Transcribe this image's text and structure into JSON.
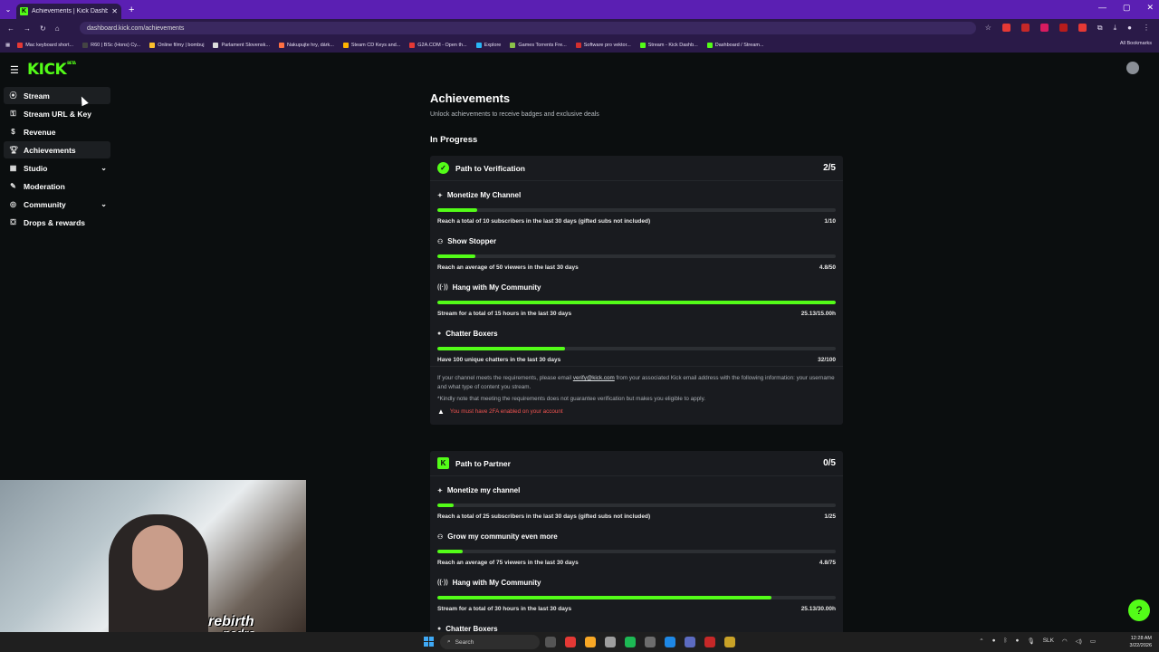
{
  "browser": {
    "tab_title": "Achievements | Kick Dashboard",
    "tab_favicon": "K",
    "url": "dashboard.kick.com/achievements",
    "bookmarks": [
      "Mac keyboard short...",
      "R60 | BSc (Hons) Cy...",
      "Online filmy | bombuj",
      "Parlament Slovensk...",
      "Nakupujte hry, dárk...",
      "Steam CD Keys and...",
      "G2A.COM - Open th...",
      "Explore",
      "Games Torrents Fre...",
      "Software pro vektor...",
      "Stream - Kick Dashb...",
      "Dashboard / Stream..."
    ],
    "all_bookmarks": "All Bookmarks"
  },
  "app": {
    "logo": "KICK",
    "logo_tag": "BETA"
  },
  "sidebar": {
    "items": [
      {
        "label": "Stream",
        "icon": "broadcast-icon"
      },
      {
        "label": "Stream URL & Key",
        "icon": "key-icon"
      },
      {
        "label": "Revenue",
        "icon": "dollar-icon"
      },
      {
        "label": "Achievements",
        "icon": "trophy-icon"
      },
      {
        "label": "Studio",
        "icon": "studio-icon"
      },
      {
        "label": "Moderation",
        "icon": "wrench-icon"
      },
      {
        "label": "Community",
        "icon": "globe-icon"
      },
      {
        "label": "Drops & rewards",
        "icon": "gift-icon"
      }
    ]
  },
  "main": {
    "title": "Achievements",
    "subtitle": "Unlock achievements to receive badges and exclusive deals",
    "section": "In Progress",
    "verification": {
      "title": "Path to Verification",
      "count": "2/5",
      "tasks": [
        {
          "title": "Monetize My Channel",
          "desc": "Reach a total of 10 subscribers in the last 30 days (gifted subs not included)",
          "progress": "1/10",
          "fraction": 0.1
        },
        {
          "title": "Show Stopper",
          "desc": "Reach an average of 50 viewers in the last 30 days",
          "progress": "4.8/50",
          "fraction": 0.096
        },
        {
          "title": "Hang with My Community",
          "desc": "Stream for a total of 15 hours in the last 30 days",
          "progress": "25.13/15.00h",
          "fraction": 1.0
        },
        {
          "title": "Chatter Boxers",
          "desc": "Have 100 unique chatters in the last 30 days",
          "progress": "32/100",
          "fraction": 0.32
        }
      ],
      "note_1a": "If your channel meets the requirements, please email ",
      "note_email": "verify@kick.com",
      "note_1b": " from your associated Kick email address with the following information: your username and what type of content you stream.",
      "note_2": "*Kindly note that meeting the requirements does not guarantee verification but makes you eligible to apply.",
      "warning": "You must have 2FA enabled on your account"
    },
    "partner": {
      "title": "Path to Partner",
      "count": "0/5",
      "tasks": [
        {
          "title": "Monetize my channel",
          "desc": "Reach a total of 25 subscribers in the last 30 days (gifted subs not included)",
          "progress": "1/25",
          "fraction": 0.04
        },
        {
          "title": "Grow my community even more",
          "desc": "Reach an average of 75 viewers in the last 30 days",
          "progress": "4.8/75",
          "fraction": 0.064
        },
        {
          "title": "Hang with My Community",
          "desc": "Stream for a total of 30 hours in the last 30 days",
          "progress": "25.13/30.00h",
          "fraction": 0.838
        },
        {
          "title": "Chatter Boxers",
          "desc": "",
          "progress": "",
          "fraction": 0
        }
      ]
    }
  },
  "overlay": {
    "brand_line1": "rebirth",
    "brand_line2": "pedro"
  },
  "taskbar": {
    "search": "Search",
    "lang": "SLK",
    "time": "12:28 AM",
    "date": "3/22/2026"
  },
  "colors": {
    "accent": "#53fc18",
    "warning": "#ef5350",
    "card": "#191b1f"
  }
}
